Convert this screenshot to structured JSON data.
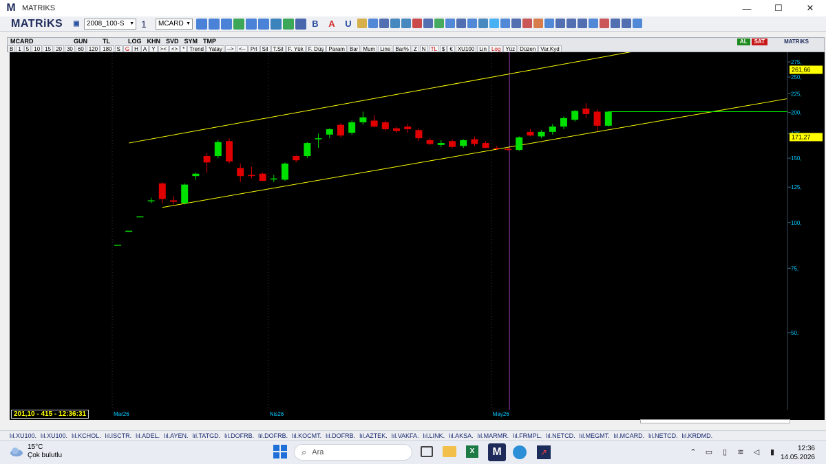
{
  "window": {
    "title": "MATRIKS",
    "logo_letter": "M",
    "controls": {
      "minimize": "—",
      "maximize": "☐",
      "close": "✕"
    }
  },
  "toolbar": {
    "brand": "MATRiKS",
    "template_value": "2008_100-S",
    "layout_value": "1",
    "symbol_value": "MCARD",
    "buttons": [
      "B",
      "A",
      "U"
    ]
  },
  "chart_window": {
    "symbol": "MCARD",
    "period": "GUN",
    "currency": "TL",
    "tabs": [
      "LOG",
      "KHN",
      "SVD",
      "SYM",
      "TMP"
    ],
    "commands": [
      "B",
      "1",
      "5",
      "10",
      "15",
      "20",
      "30",
      "60",
      "120",
      "180",
      "S",
      "G",
      "H",
      "A",
      "Y",
      "><",
      "<>",
      "*",
      "Trend",
      "Yatay",
      "-->",
      "<--",
      "Prl",
      "Sil",
      "T.Sil",
      "F. Yük",
      "F. Düş",
      "Param",
      "Bar",
      "Mum",
      "Line",
      "Bar%",
      "Z",
      "N",
      "TL",
      "$",
      "€",
      "XU100",
      "Lin",
      "Log",
      "Yüz",
      "Düzen",
      "Var.Kyd"
    ],
    "buy_label": "AL",
    "sell_label": "SAT",
    "corner_brand": "MATRiKS"
  },
  "chart_data": {
    "type": "candlestick",
    "scale": "log",
    "y_ticks": [
      "275",
      "250",
      "225",
      "200",
      "175",
      "150",
      "125",
      "100",
      "75",
      "50"
    ],
    "y_tick_values": [
      275,
      250,
      225,
      200,
      175,
      150,
      125,
      100,
      75,
      50
    ],
    "price_tag_upper": "261,66",
    "price_tag_lower": "171,27",
    "x_labels": [
      {
        "label": "Mar26",
        "index": 0
      },
      {
        "label": "Nis26",
        "index": 14
      },
      {
        "label": "May26",
        "index": 34
      }
    ],
    "candles": [
      {
        "o": 87,
        "h": 87,
        "l": 87,
        "c": 87
      },
      {
        "o": 95,
        "h": 95,
        "l": 95,
        "c": 95
      },
      {
        "o": 104,
        "h": 104,
        "l": 104,
        "c": 104
      },
      {
        "o": 115,
        "h": 117,
        "l": 113,
        "c": 115
      },
      {
        "o": 128,
        "h": 129,
        "l": 113,
        "c": 116
      },
      {
        "o": 115,
        "h": 118,
        "l": 112,
        "c": 114
      },
      {
        "o": 113,
        "h": 128,
        "l": 112,
        "c": 127
      },
      {
        "o": 134,
        "h": 137,
        "l": 131,
        "c": 136
      },
      {
        "o": 152,
        "h": 155,
        "l": 137,
        "c": 146
      },
      {
        "o": 152,
        "h": 168,
        "l": 150,
        "c": 166
      },
      {
        "o": 167,
        "h": 170,
        "l": 145,
        "c": 147
      },
      {
        "o": 141,
        "h": 145,
        "l": 129,
        "c": 134
      },
      {
        "o": 135,
        "h": 142,
        "l": 132,
        "c": 134
      },
      {
        "o": 136,
        "h": 137,
        "l": 130,
        "c": 130
      },
      {
        "o": 132,
        "h": 135,
        "l": 129,
        "c": 132
      },
      {
        "o": 131,
        "h": 146,
        "l": 130,
        "c": 145
      },
      {
        "o": 152,
        "h": 153,
        "l": 146,
        "c": 148
      },
      {
        "o": 152,
        "h": 166,
        "l": 150,
        "c": 165
      },
      {
        "o": 170,
        "h": 175,
        "l": 160,
        "c": 170
      },
      {
        "o": 174,
        "h": 181,
        "l": 170,
        "c": 180
      },
      {
        "o": 185,
        "h": 187,
        "l": 171,
        "c": 173
      },
      {
        "o": 176,
        "h": 190,
        "l": 174,
        "c": 188
      },
      {
        "o": 188,
        "h": 201,
        "l": 185,
        "c": 194
      },
      {
        "o": 190,
        "h": 197,
        "l": 182,
        "c": 183
      },
      {
        "o": 188,
        "h": 190,
        "l": 178,
        "c": 180
      },
      {
        "o": 181,
        "h": 183,
        "l": 176,
        "c": 178
      },
      {
        "o": 183,
        "h": 186,
        "l": 176,
        "c": 180
      },
      {
        "o": 179,
        "h": 181,
        "l": 167,
        "c": 170
      },
      {
        "o": 168,
        "h": 170,
        "l": 163,
        "c": 164
      },
      {
        "o": 163,
        "h": 168,
        "l": 161,
        "c": 165
      },
      {
        "o": 167,
        "h": 169,
        "l": 160,
        "c": 161
      },
      {
        "o": 162,
        "h": 169,
        "l": 160,
        "c": 168
      },
      {
        "o": 169,
        "h": 172,
        "l": 162,
        "c": 164
      },
      {
        "o": 165,
        "h": 167,
        "l": 160,
        "c": 160
      },
      {
        "o": 160,
        "h": 162,
        "l": 158,
        "c": 159
      },
      {
        "o": 159,
        "h": 160,
        "l": 157,
        "c": 158
      },
      {
        "o": 158,
        "h": 172,
        "l": 157,
        "c": 171
      },
      {
        "o": 177,
        "h": 180,
        "l": 172,
        "c": 173
      },
      {
        "o": 172,
        "h": 179,
        "l": 170,
        "c": 177
      },
      {
        "o": 177,
        "h": 186,
        "l": 174,
        "c": 183
      },
      {
        "o": 183,
        "h": 195,
        "l": 180,
        "c": 193
      },
      {
        "o": 191,
        "h": 203,
        "l": 189,
        "c": 202
      },
      {
        "o": 205,
        "h": 212,
        "l": 193,
        "c": 198
      },
      {
        "o": 201,
        "h": 204,
        "l": 178,
        "c": 184
      },
      {
        "o": 184,
        "h": 201,
        "l": 183,
        "c": 201
      }
    ],
    "channel_upper": [
      {
        "i": 1,
        "p": 165
      },
      {
        "i": 53,
        "p": 320
      }
    ],
    "channel_lower": [
      {
        "i": 4,
        "p": 110
      },
      {
        "i": 60,
        "p": 218
      }
    ],
    "horizontal_level": 201,
    "colors": {
      "up": "#00e000",
      "down": "#e00000",
      "channel": "#ffff00",
      "hline": "#00ff00",
      "axis_text": "#00c8ff",
      "cursor": "#a040c0"
    }
  },
  "status": {
    "readout": "201,10 - 415 - 12:36:31"
  },
  "symbol_bar": [
    ".XU100.",
    ".XU100.",
    ".KCHOL.",
    ".ISCTR.",
    ".ADEL.",
    ".AYEN.",
    ".TATGD.",
    ".DOFRB.",
    ".DOFRB.",
    ".KOCMT.",
    ".DOFRB.",
    ".AZTEK.",
    ".VAKFA.",
    ".LINK.",
    ".AKSA.",
    ".MARMR.",
    ".FRMPL.",
    ".NETCD.",
    ".MEGMT.",
    ".MCARD.",
    ".NETCD.",
    ".KRDMD."
  ],
  "taskbar": {
    "weather_temp": "15°C",
    "weather_desc": "Çok bulutlu",
    "search_placeholder": "Ara",
    "time": "12:36",
    "date": "14.05.2026"
  }
}
